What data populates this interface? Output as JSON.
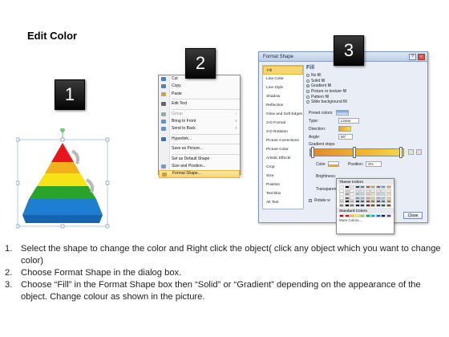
{
  "title": "Edit Color",
  "badges": [
    "1",
    "2",
    "3"
  ],
  "context_menu": {
    "items": [
      {
        "label": "Cut",
        "icon": "scissors-icon",
        "color": "#4a7fc1"
      },
      {
        "label": "Copy",
        "icon": "copy-icon",
        "color": "#5a7fb0"
      },
      {
        "label": "Paste",
        "icon": "paste-icon",
        "color": "#c9a246"
      },
      {
        "sep": true
      },
      {
        "label": "Edit Text",
        "icon": "edit-text-icon",
        "color": "#666"
      },
      {
        "sep": true
      },
      {
        "label": "Group",
        "icon": "group-icon",
        "color": "#9aa",
        "arrow": true,
        "disabled": true
      },
      {
        "label": "Bring to Front",
        "icon": "bring-front-icon",
        "color": "#6b8fc6",
        "arrow": true
      },
      {
        "label": "Send to Back",
        "icon": "send-back-icon",
        "color": "#6b8fc6",
        "arrow": true
      },
      {
        "sep": true
      },
      {
        "label": "Hyperlink...",
        "icon": "hyperlink-icon",
        "color": "#3b6fc0"
      },
      {
        "sep": true
      },
      {
        "label": "Save as Picture...",
        "icon": "",
        "color": ""
      },
      {
        "sep": true
      },
      {
        "label": "Set as Default Shape",
        "icon": "",
        "color": ""
      },
      {
        "label": "Size and Position...",
        "icon": "size-position-icon",
        "color": "#7a9ac8"
      },
      {
        "label": "Format Shape...",
        "icon": "format-shape-icon",
        "color": "#d59a3a",
        "highlight": true
      }
    ]
  },
  "dialog": {
    "title": "Format Shape",
    "left_items": [
      "Fill",
      "Line Color",
      "Line Style",
      "Shadow",
      "Reflection",
      "Glow and Soft Edges",
      "3-D Format",
      "3-D Rotation",
      "Picture Corrections",
      "Picture Color",
      "Artistic Effects",
      "Crop",
      "Size",
      "Position",
      "Text Box",
      "Alt Text"
    ],
    "selected_left": "Fill",
    "section_title": "Fill",
    "fill_options": [
      {
        "label": "No fill",
        "on": false
      },
      {
        "label": "Solid fill",
        "on": false
      },
      {
        "label": "Gradient fill",
        "on": true
      },
      {
        "label": "Picture or texture fill",
        "on": false
      },
      {
        "label": "Pattern fill",
        "on": false
      },
      {
        "label": "Slide background fill",
        "on": false
      }
    ],
    "preset_colors_label": "Preset colors:",
    "type_label": "Type:",
    "type_value": "Linear",
    "direction_label": "Direction:",
    "angle_label": "Angle:",
    "angle_value": "90°",
    "gradient_stops_label": "Gradient stops",
    "color_label": "Color",
    "position_label": "Position:",
    "position_value": "0%",
    "brightness_label": "Brightness:",
    "transparency_label": "Transparency:",
    "rotate_label": "Rotate w",
    "close_label": "Close",
    "palette_theme_title": "Theme Colors",
    "palette_standard_title": "Standard Colors",
    "palette_more": "More Colors...",
    "palette_top_row": [
      "#ffffff",
      "#000000",
      "#eeece1",
      "#1f497d",
      "#4f81bd",
      "#c0504d",
      "#9bbb59",
      "#8064a2",
      "#4bacc6",
      "#f79646"
    ],
    "palette_standard": [
      "#c00000",
      "#ff0000",
      "#ffc000",
      "#ffff00",
      "#92d050",
      "#00b050",
      "#00b0f0",
      "#0070c0",
      "#002060",
      "#7030a0"
    ]
  },
  "steps": [
    {
      "num": "1.",
      "text": "Select the shape to change the color and Right click the object( click any object which you want to change color)"
    },
    {
      "num": "2.",
      "text": "Choose Format Shape in the dialog box."
    },
    {
      "num": "3.",
      "text": "Choose “Fill” in the Format Shape box then “Solid” or “Gradient” depending on the appearance of the object. Change colour as shown in the picture."
    }
  ]
}
